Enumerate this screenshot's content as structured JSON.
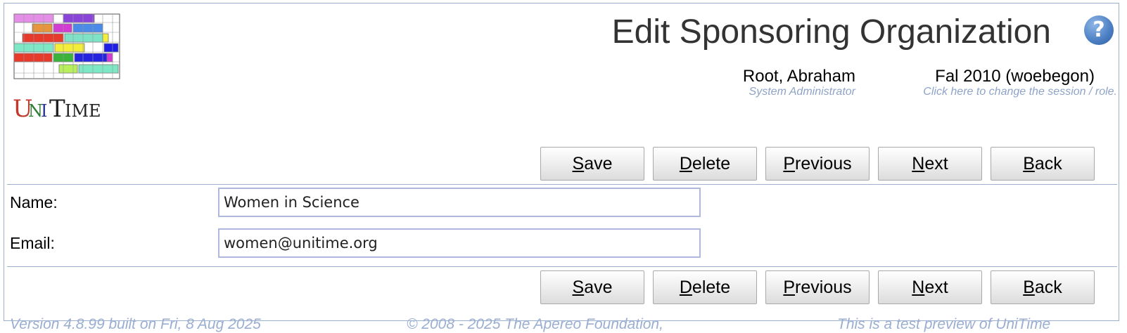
{
  "header": {
    "app_name": "UniTime",
    "page_title": "Edit Sponsoring Organization",
    "user_name": "Root, Abraham",
    "user_role": "System Administrator",
    "session_name": "Fal 2010 (woebegon)",
    "session_hint": "Click here to change the session / role.",
    "help_icon": "question-mark-icon"
  },
  "toolbar": {
    "buttons": [
      {
        "key": "S",
        "rest": "ave"
      },
      {
        "key": "D",
        "rest": "elete"
      },
      {
        "key": "P",
        "rest": "revious"
      },
      {
        "key": "N",
        "rest": "ext"
      },
      {
        "key": "B",
        "rest": "ack"
      }
    ]
  },
  "form": {
    "name_label": "Name:",
    "name_value": "Women in Science",
    "email_label": "Email:",
    "email_value": "women@unitime.org"
  },
  "footer": {
    "version": "Version 4.8.99 built on Fri, 8 Aug 2025",
    "copyright": "© 2008 - 2025 The Apereo Foundation,",
    "note": "This is a test preview of UniTime"
  },
  "colors": {
    "border": "#9cb0ce",
    "hint": "#8ea3c8"
  }
}
